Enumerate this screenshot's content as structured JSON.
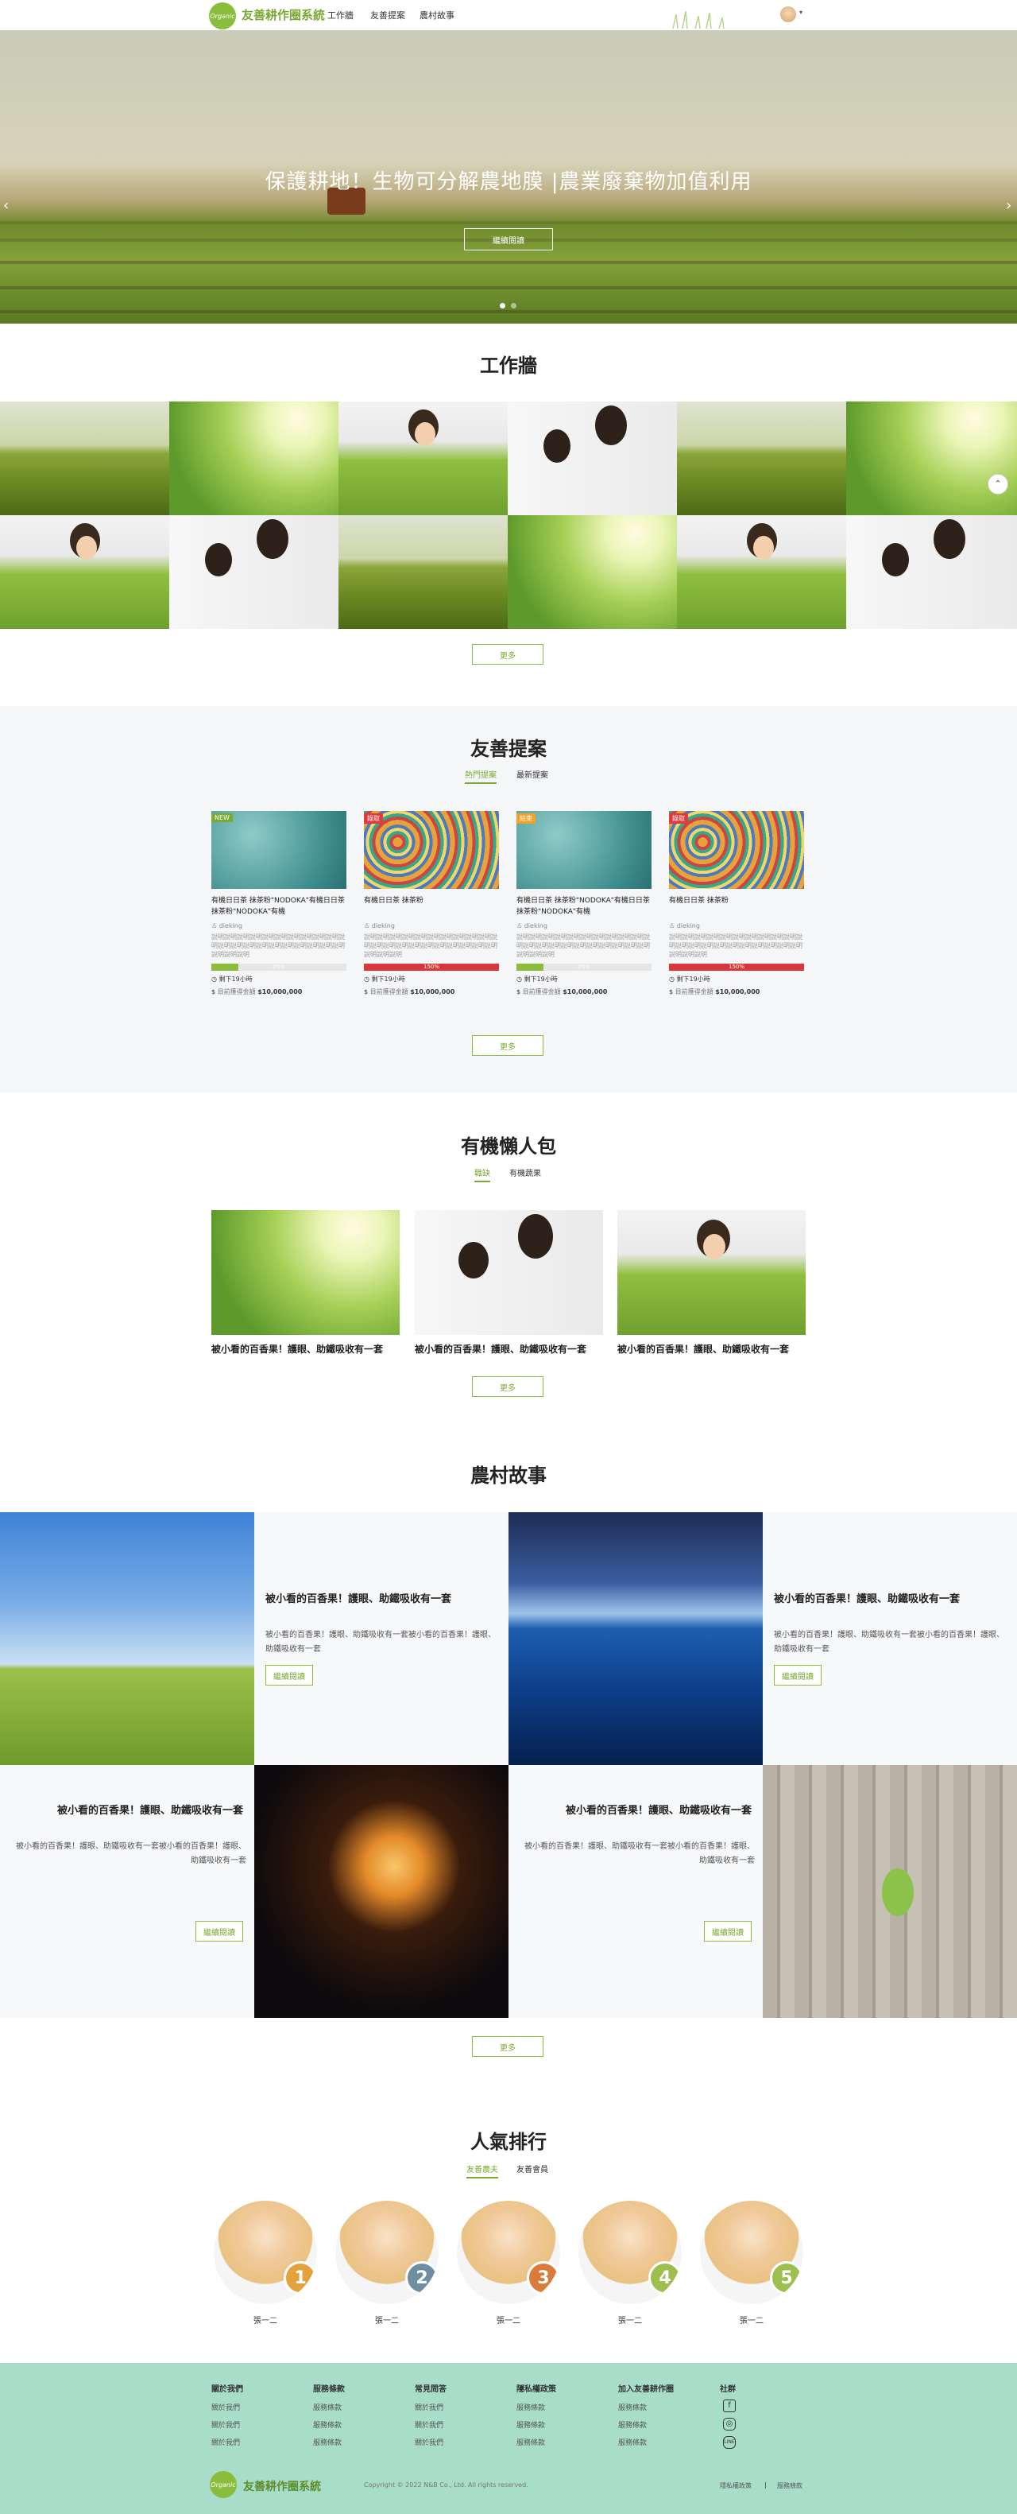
{
  "header": {
    "logo_text": "Organic",
    "brand": "友善耕作圈系統",
    "nav": [
      "工作牆",
      "友善提案",
      "農村故事"
    ],
    "user_caret": "▾"
  },
  "hero": {
    "title": "保護耕地！生物可分解農地膜 |農業廢棄物加值利用",
    "button": "繼續閱讀",
    "prev": "‹",
    "next": "›"
  },
  "wall": {
    "title": "工作牆",
    "more": "更多"
  },
  "proposals": {
    "title": "友善提案",
    "tabs": [
      "熱門提案",
      "最新提案"
    ],
    "more": "更多",
    "cards": [
      {
        "badge": "NEW",
        "badge_color": "#7aaa34",
        "title": "有機日日茶 抹茶粉\"NODOKA\"有機日日茶 抹茶粉\"NODOKA\"有機",
        "user": "dieking",
        "desc": "說明說明說明說明說明說明說明說明說明說明說明說明說明說明說明說明說明說明說明說明說明說明說明說明",
        "progress_label": "20%",
        "progress": 0.2,
        "progress_color": "#8bbd3c",
        "days": "剩下19小時",
        "money_label": "目前獲得金額",
        "money": "$10,000,000"
      },
      {
        "badge": "錄取",
        "badge_color": "#e0393e",
        "title": "有機日日茶 抹茶粉",
        "user": "dieking",
        "desc": "說明說明說明說明說明說明說明說明說明說明說明說明說明說明說明說明說明說明說明說明說明說明說明說明",
        "progress_label": "150%",
        "progress": 1,
        "progress_color": "#d9363e",
        "days": "剩下19小時",
        "money_label": "目前獲得金額",
        "money": "$10,000,000"
      },
      {
        "badge": "結束",
        "badge_color": "#f0a22a",
        "title": "有機日日茶 抹茶粉\"NODOKA\"有機日日茶 抹茶粉\"NODOKA\"有機",
        "user": "dieking",
        "desc": "說明說明說明說明說明說明說明說明說明說明說明說明說明說明說明說明說明說明說明說明說明說明說明說明",
        "progress_label": "20%",
        "progress": 0.2,
        "progress_color": "#8bbd3c",
        "days": "剩下19小時",
        "money_label": "目前獲得金額",
        "money": "$10,000,000"
      },
      {
        "badge": "錄取",
        "badge_color": "#e0393e",
        "title": "有機日日茶 抹茶粉",
        "user": "dieking",
        "desc": "說明說明說明說明說明說明說明說明說明說明說明說明說明說明說明說明說明說明說明說明說明說明說明說明",
        "progress_label": "150%",
        "progress": 1,
        "progress_color": "#d9363e",
        "days": "剩下19小時",
        "money_label": "目前獲得金額",
        "money": "$10,000,000"
      }
    ]
  },
  "pack": {
    "title": "有機懶人包",
    "tabs": [
      "職缺",
      "有機蔬果"
    ],
    "more": "更多",
    "items": [
      "被小看的百香果！護眼、助鐵吸收有一套",
      "被小看的百香果！護眼、助鐵吸收有一套",
      "被小看的百香果！護眼、助鐵吸收有一套"
    ]
  },
  "stories": {
    "title": "農村故事",
    "more": "更多",
    "items": [
      {
        "title": "被小看的百香果！護眼、助鐵吸收有一套",
        "desc": "被小看的百香果！護眼、助鐵吸收有一套被小看的百香果！護眼、助鐵吸收有一套",
        "button": "繼續閱讀"
      },
      {
        "title": "被小看的百香果！護眼、助鐵吸收有一套",
        "desc": "被小看的百香果！護眼、助鐵吸收有一套被小看的百香果！護眼、助鐵吸收有一套",
        "button": "繼續閱讀"
      },
      {
        "title": "被小看的百香果！護眼、助鐵吸收有一套",
        "desc": "被小看的百香果！護眼、助鐵吸收有一套被小看的百香果！護眼、助鐵吸收有一套",
        "button": "繼續閱讀"
      },
      {
        "title": "被小看的百香果！護眼、助鐵吸收有一套",
        "desc": "被小看的百香果！護眼、助鐵吸收有一套被小看的百香果！護眼、助鐵吸收有一套",
        "button": "繼續閱讀"
      }
    ]
  },
  "ranking": {
    "title": "人氣排行",
    "tabs": [
      "友善農夫",
      "友善會員"
    ],
    "items": [
      {
        "rank": "1",
        "name": "張一二",
        "color": "#e3a23b"
      },
      {
        "rank": "2",
        "name": "張一二",
        "color": "#6e8fa3"
      },
      {
        "rank": "3",
        "name": "張一二",
        "color": "#d97b3a"
      },
      {
        "rank": "4",
        "name": "張一二",
        "color": "#9cbf4d"
      },
      {
        "rank": "5",
        "name": "張一二",
        "color": "#9cbf4d"
      }
    ]
  },
  "footer": {
    "columns": [
      {
        "head": "關於我們",
        "items": [
          "關於我們",
          "關於我們",
          "關於我們"
        ]
      },
      {
        "head": "服務條款",
        "items": [
          "服務條款",
          "服務條款",
          "服務條款"
        ]
      },
      {
        "head": "常見問答",
        "items": [
          "關於我們",
          "關於我們",
          "關於我們"
        ]
      },
      {
        "head": "隱私權政策",
        "items": [
          "服務條款",
          "服務條款",
          "服務條款"
        ]
      },
      {
        "head": "加入友善耕作圈",
        "items": [
          "服務條款",
          "服務條款",
          "服務條款"
        ]
      }
    ],
    "social_head": "社群",
    "social_icons": [
      "facebook-icon",
      "instagram-icon",
      "line-icon"
    ],
    "brand": "友善耕作圈系統",
    "copyright": "Copyright © 2022 N&B Co., Ltd. All rights reserved.",
    "links": [
      "隱私權政策",
      "服務條款"
    ],
    "sep": "|"
  }
}
